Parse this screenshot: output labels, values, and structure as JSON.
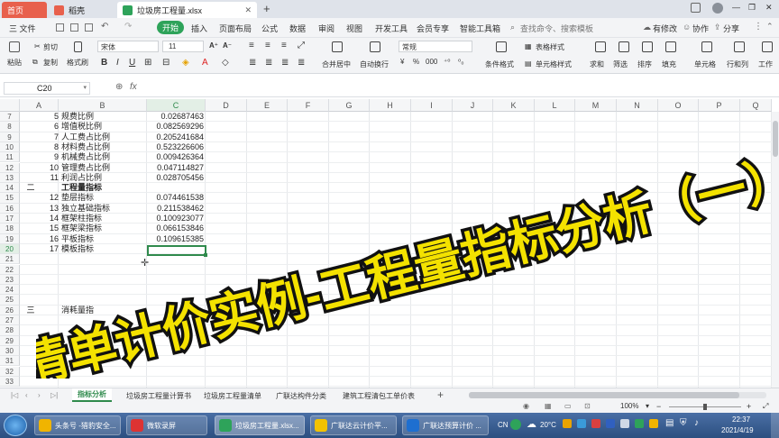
{
  "tabs": [
    {
      "label": "首页",
      "color": "#e04a3a"
    },
    {
      "label": "稻壳",
      "color": "#e8604c"
    },
    {
      "label": "垃圾房工程量.xlsx",
      "color": "#2ea35a"
    }
  ],
  "window_controls": {
    "min": "—",
    "max": "❐",
    "close": "✕"
  },
  "menu": {
    "file": "三 文件",
    "tabs": [
      "开始",
      "插入",
      "页面布局",
      "公式",
      "数据",
      "审阅",
      "视图",
      "开发工具",
      "会员专享",
      "智能工具箱"
    ],
    "search": "查找命令、搜索模板",
    "edit_state": "有修改",
    "collab": "协作",
    "share": "分享"
  },
  "ribbon": {
    "paste": "粘贴",
    "cut": "剪切",
    "copy": "复制",
    "format_painter": "格式刷",
    "font_name": "宋体",
    "font_size": "11",
    "merge": "合并居中",
    "wrap": "自动换行",
    "number_format": "常规",
    "cond_format": "条件格式",
    "cell_style": "单元格样式",
    "table_style": "表格样式",
    "sum": "求和",
    "filter": "筛选",
    "sort": "排序",
    "fill": "填充",
    "cell": "单元格",
    "rowcol": "行和列",
    "sheet": "工作"
  },
  "formula_bar": {
    "name_box": "C20",
    "fx": "fx",
    "content": ""
  },
  "columns": [
    "A",
    "B",
    "C",
    "D",
    "E",
    "F",
    "G",
    "H",
    "I",
    "J",
    "K",
    "L",
    "M",
    "N",
    "O",
    "P",
    "Q"
  ],
  "rows": [
    {
      "r": "7",
      "a": "",
      "n": "5",
      "b": "规费比例",
      "c": "0.02687463"
    },
    {
      "r": "8",
      "a": "",
      "n": "6",
      "b": "增值税比例",
      "c": "0.082569296"
    },
    {
      "r": "9",
      "a": "",
      "n": "7",
      "b": "人工费占比例",
      "c": "0.205241684"
    },
    {
      "r": "10",
      "a": "",
      "n": "8",
      "b": "材料费占比例",
      "c": "0.523226606"
    },
    {
      "r": "11",
      "a": "",
      "n": "9",
      "b": "机械费占比例",
      "c": "0.009426364"
    },
    {
      "r": "12",
      "a": "",
      "n": "10",
      "b": "管理费占比例",
      "c": "0.047114827"
    },
    {
      "r": "13",
      "a": "",
      "n": "11",
      "b": "利润占比例",
      "c": "0.028705456"
    },
    {
      "r": "14",
      "a": "二",
      "n": "",
      "b": "工程量指标",
      "c": "",
      "bold": true
    },
    {
      "r": "15",
      "a": "",
      "n": "12",
      "b": "垫层指标",
      "c": "0.074461538"
    },
    {
      "r": "16",
      "a": "",
      "n": "13",
      "b": "独立基础指标",
      "c": "0.211538462"
    },
    {
      "r": "17",
      "a": "",
      "n": "14",
      "b": "框架柱指标",
      "c": "0.100923077"
    },
    {
      "r": "18",
      "a": "",
      "n": "15",
      "b": "框架梁指标",
      "c": "0.066153846"
    },
    {
      "r": "19",
      "a": "",
      "n": "16",
      "b": "平板指标",
      "c": "0.109615385"
    },
    {
      "r": "20",
      "a": "",
      "n": "17",
      "b": "模板指标",
      "c": ""
    },
    {
      "r": "21",
      "a": "",
      "n": "",
      "b": "",
      "c": ""
    },
    {
      "r": "22",
      "a": "",
      "n": "",
      "b": "",
      "c": ""
    },
    {
      "r": "23",
      "a": "",
      "n": "",
      "b": "",
      "c": ""
    },
    {
      "r": "24",
      "a": "",
      "n": "",
      "b": "",
      "c": ""
    },
    {
      "r": "25",
      "a": "",
      "n": "",
      "b": "",
      "c": ""
    },
    {
      "r": "26",
      "a": "三",
      "n": "",
      "b": "消耗量指",
      "c": ""
    },
    {
      "r": "27",
      "a": "",
      "n": "",
      "b": "",
      "c": ""
    },
    {
      "r": "28",
      "a": "",
      "n": "",
      "b": "",
      "c": ""
    },
    {
      "r": "29",
      "a": "",
      "n": "",
      "b": "",
      "c": ""
    },
    {
      "r": "30",
      "a": "",
      "n": "",
      "b": "",
      "c": ""
    },
    {
      "r": "31",
      "a": "",
      "n": "",
      "b": "",
      "c": ""
    },
    {
      "r": "32",
      "a": "",
      "n": "",
      "b": "",
      "c": ""
    },
    {
      "r": "33",
      "a": "",
      "n": "",
      "b": "",
      "c": ""
    }
  ],
  "overlay_title": "清单计价实例-工程量指标分析（一）",
  "sheet_tabs": [
    "指标分析",
    "垃圾房工程量计算书",
    "垃圾房工程量清单",
    "广联达构件分类",
    "建筑工程清包工单价表"
  ],
  "zoom": "100%",
  "taskbar": {
    "items": [
      "头条号 -猎豹安全...",
      "微软录屏",
      "垃圾房工程量.xlsx...",
      "广联达云计价平...",
      "广联达预算计价 ..."
    ],
    "tray": {
      "lang": "CN",
      "temp": "20°C",
      "time": "22:37",
      "date": "2021/4/19"
    }
  }
}
